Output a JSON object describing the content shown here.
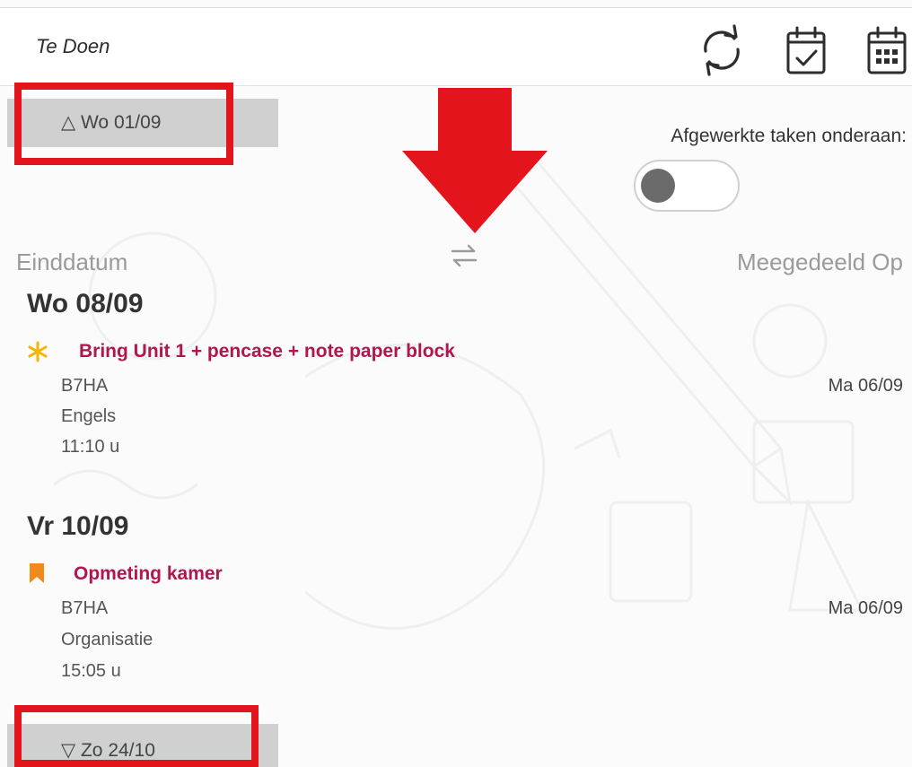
{
  "header": {
    "title": "Te Doen",
    "icons": [
      "refresh-icon",
      "calendar-check-icon",
      "calendar-grid-icon"
    ]
  },
  "nav": {
    "prev_label": "△ Wo 01/09",
    "next_label": "▽ Zo 24/10"
  },
  "toggle": {
    "label": "Afgewerkte taken onderaan:",
    "state": "off"
  },
  "columns": {
    "left": "Einddatum",
    "right": "Meegedeeld Op"
  },
  "days": [
    {
      "label": "Wo 08/09",
      "task": {
        "icon": "asterisk-icon",
        "title": "Bring Unit 1 + pencase + note paper block",
        "class": "B7HA",
        "subject": "Engels",
        "time": "11:10 u",
        "given": "Ma 06/09"
      }
    },
    {
      "label": "Vr 10/09",
      "task": {
        "icon": "bookmark-icon",
        "title": "Opmeting kamer",
        "class": "B7HA",
        "subject": "Organisatie",
        "time": "15:05 u",
        "given": "Ma 06/09"
      }
    }
  ],
  "colors": {
    "highlight": "#e3141b",
    "task_title": "#b0174e",
    "asterisk": "#f5b400",
    "bookmark": "#f28a1a"
  }
}
